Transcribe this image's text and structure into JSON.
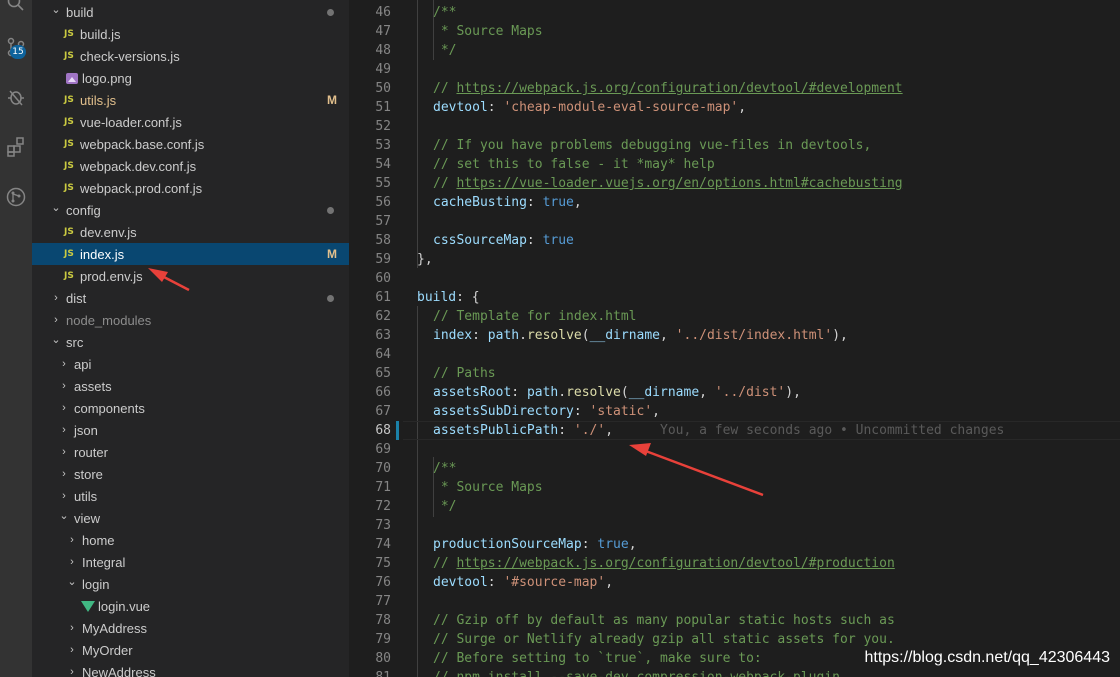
{
  "activity_bar": {
    "icons": [
      "search-icon",
      "source-control-icon",
      "debug-icon",
      "extensions-icon",
      "git-graph-icon"
    ],
    "scm_badge": "15"
  },
  "explorer": {
    "rows": [
      {
        "label": "build",
        "kind": "folder-open",
        "indent": 0,
        "marker": "dot"
      },
      {
        "label": "build.js",
        "kind": "js",
        "indent": 1
      },
      {
        "label": "check-versions.js",
        "kind": "js",
        "indent": 1
      },
      {
        "label": "logo.png",
        "kind": "img",
        "indent": 1
      },
      {
        "label": "utils.js",
        "kind": "js",
        "indent": 1,
        "status": "M"
      },
      {
        "label": "vue-loader.conf.js",
        "kind": "js",
        "indent": 1
      },
      {
        "label": "webpack.base.conf.js",
        "kind": "js",
        "indent": 1
      },
      {
        "label": "webpack.dev.conf.js",
        "kind": "js",
        "indent": 1
      },
      {
        "label": "webpack.prod.conf.js",
        "kind": "js",
        "indent": 1
      },
      {
        "label": "config",
        "kind": "folder-open",
        "indent": 0,
        "marker": "dot"
      },
      {
        "label": "dev.env.js",
        "kind": "js",
        "indent": 1
      },
      {
        "label": "index.js",
        "kind": "js",
        "indent": 1,
        "status": "M",
        "selected": true
      },
      {
        "label": "prod.env.js",
        "kind": "js",
        "indent": 1
      },
      {
        "label": "dist",
        "kind": "folder-closed",
        "indent": 0,
        "marker": "dot"
      },
      {
        "label": "node_modules",
        "kind": "folder-closed",
        "indent": 0,
        "dim": true
      },
      {
        "label": "src",
        "kind": "folder-open",
        "indent": 0
      },
      {
        "label": "api",
        "kind": "folder-closed",
        "indent": 1
      },
      {
        "label": "assets",
        "kind": "folder-closed",
        "indent": 1
      },
      {
        "label": "components",
        "kind": "folder-closed",
        "indent": 1
      },
      {
        "label": "json",
        "kind": "folder-closed",
        "indent": 1
      },
      {
        "label": "router",
        "kind": "folder-closed",
        "indent": 1
      },
      {
        "label": "store",
        "kind": "folder-closed",
        "indent": 1
      },
      {
        "label": "utils",
        "kind": "folder-closed",
        "indent": 1
      },
      {
        "label": "view",
        "kind": "folder-open",
        "indent": 1
      },
      {
        "label": "home",
        "kind": "folder-closed",
        "indent": 2
      },
      {
        "label": "Integral",
        "kind": "folder-closed",
        "indent": 2
      },
      {
        "label": "login",
        "kind": "folder-open",
        "indent": 2
      },
      {
        "label": "login.vue",
        "kind": "vue",
        "indent": 3
      },
      {
        "label": "MyAddress",
        "kind": "folder-closed",
        "indent": 2
      },
      {
        "label": "MyOrder",
        "kind": "folder-closed",
        "indent": 2
      },
      {
        "label": "NewAddress",
        "kind": "folder-closed",
        "indent": 2
      }
    ]
  },
  "editor": {
    "active_line": 68,
    "lines": [
      {
        "n": 46,
        "indent": 2,
        "tokens": [
          [
            "c",
            "/**"
          ]
        ]
      },
      {
        "n": 47,
        "indent": 2,
        "tokens": [
          [
            "c",
            " * Source Maps"
          ]
        ]
      },
      {
        "n": 48,
        "indent": 2,
        "tokens": [
          [
            "c",
            " */"
          ]
        ]
      },
      {
        "n": 49,
        "indent": 0,
        "tokens": []
      },
      {
        "n": 50,
        "indent": 2,
        "tokens": [
          [
            "c",
            "// "
          ],
          [
            "u",
            "https://webpack.js.org/configuration/devtool/#development"
          ]
        ]
      },
      {
        "n": 51,
        "indent": 2,
        "tokens": [
          [
            "k",
            "devtool"
          ],
          [
            "p",
            ": "
          ],
          [
            "s",
            "'cheap-module-eval-source-map'"
          ],
          [
            "p",
            ","
          ]
        ]
      },
      {
        "n": 52,
        "indent": 0,
        "tokens": []
      },
      {
        "n": 53,
        "indent": 2,
        "tokens": [
          [
            "c",
            "// If you have problems debugging vue-files in devtools,"
          ]
        ]
      },
      {
        "n": 54,
        "indent": 2,
        "tokens": [
          [
            "c",
            "// set this to false - it *may* help"
          ]
        ]
      },
      {
        "n": 55,
        "indent": 2,
        "tokens": [
          [
            "c",
            "// "
          ],
          [
            "u",
            "https://vue-loader.vuejs.org/en/options.html#cachebusting"
          ]
        ]
      },
      {
        "n": 56,
        "indent": 2,
        "tokens": [
          [
            "k",
            "cacheBusting"
          ],
          [
            "p",
            ": "
          ],
          [
            "b",
            "true"
          ],
          [
            "p",
            ","
          ]
        ]
      },
      {
        "n": 57,
        "indent": 0,
        "tokens": []
      },
      {
        "n": 58,
        "indent": 2,
        "tokens": [
          [
            "k",
            "cssSourceMap"
          ],
          [
            "p",
            ": "
          ],
          [
            "b",
            "true"
          ]
        ]
      },
      {
        "n": 59,
        "indent": 1,
        "tokens": [
          [
            "p",
            "},"
          ]
        ]
      },
      {
        "n": 60,
        "indent": 0,
        "tokens": []
      },
      {
        "n": 61,
        "indent": 1,
        "tokens": [
          [
            "k",
            "build"
          ],
          [
            "p",
            ": {"
          ]
        ]
      },
      {
        "n": 62,
        "indent": 2,
        "tokens": [
          [
            "c",
            "// Template for index.html"
          ]
        ]
      },
      {
        "n": 63,
        "indent": 2,
        "tokens": [
          [
            "k",
            "index"
          ],
          [
            "p",
            ": "
          ],
          [
            "k",
            "path"
          ],
          [
            "p",
            "."
          ],
          [
            "f",
            "resolve"
          ],
          [
            "p",
            "("
          ],
          [
            "k",
            "__dirname"
          ],
          [
            "p",
            ", "
          ],
          [
            "s",
            "'../dist/index.html'"
          ],
          [
            "p",
            "),"
          ]
        ]
      },
      {
        "n": 64,
        "indent": 0,
        "tokens": []
      },
      {
        "n": 65,
        "indent": 2,
        "tokens": [
          [
            "c",
            "// Paths"
          ]
        ]
      },
      {
        "n": 66,
        "indent": 2,
        "tokens": [
          [
            "k",
            "assetsRoot"
          ],
          [
            "p",
            ": "
          ],
          [
            "k",
            "path"
          ],
          [
            "p",
            "."
          ],
          [
            "f",
            "resolve"
          ],
          [
            "p",
            "("
          ],
          [
            "k",
            "__dirname"
          ],
          [
            "p",
            ", "
          ],
          [
            "s",
            "'../dist'"
          ],
          [
            "p",
            "),"
          ]
        ]
      },
      {
        "n": 67,
        "indent": 2,
        "tokens": [
          [
            "k",
            "assetsSubDirectory"
          ],
          [
            "p",
            ": "
          ],
          [
            "s",
            "'static'"
          ],
          [
            "p",
            ","
          ]
        ]
      },
      {
        "n": 68,
        "indent": 2,
        "tokens": [
          [
            "k",
            "assetsPublicPath"
          ],
          [
            "p",
            ": "
          ],
          [
            "s",
            "'./'"
          ],
          [
            "p",
            ","
          ],
          [
            "blame",
            "      You, a few seconds ago • Uncommitted changes"
          ]
        ]
      },
      {
        "n": 69,
        "indent": 0,
        "tokens": []
      },
      {
        "n": 70,
        "indent": 2,
        "tokens": [
          [
            "c",
            "/**"
          ]
        ]
      },
      {
        "n": 71,
        "indent": 2,
        "tokens": [
          [
            "c",
            " * Source Maps"
          ]
        ]
      },
      {
        "n": 72,
        "indent": 2,
        "tokens": [
          [
            "c",
            " */"
          ]
        ]
      },
      {
        "n": 73,
        "indent": 0,
        "tokens": []
      },
      {
        "n": 74,
        "indent": 2,
        "tokens": [
          [
            "k",
            "productionSourceMap"
          ],
          [
            "p",
            ": "
          ],
          [
            "b",
            "true"
          ],
          [
            "p",
            ","
          ]
        ]
      },
      {
        "n": 75,
        "indent": 2,
        "tokens": [
          [
            "c",
            "// "
          ],
          [
            "u",
            "https://webpack.js.org/configuration/devtool/#production"
          ]
        ]
      },
      {
        "n": 76,
        "indent": 2,
        "tokens": [
          [
            "k",
            "devtool"
          ],
          [
            "p",
            ": "
          ],
          [
            "s",
            "'#source-map'"
          ],
          [
            "p",
            ","
          ]
        ]
      },
      {
        "n": 77,
        "indent": 0,
        "tokens": []
      },
      {
        "n": 78,
        "indent": 2,
        "tokens": [
          [
            "c",
            "// Gzip off by default as many popular static hosts such as"
          ]
        ]
      },
      {
        "n": 79,
        "indent": 2,
        "tokens": [
          [
            "c",
            "// Surge or Netlify already gzip all static assets for you."
          ]
        ]
      },
      {
        "n": 80,
        "indent": 2,
        "tokens": [
          [
            "c",
            "// Before setting to `true`, make sure to:"
          ]
        ]
      },
      {
        "n": 81,
        "indent": 2,
        "tokens": [
          [
            "c",
            "// npm install --save-dev compression-webpack-plugin"
          ]
        ]
      }
    ]
  },
  "watermark": "https://blog.csdn.net/qq_42306443",
  "colors": {
    "selection": "#094771",
    "modified": "#e2c08d",
    "arrow": "#e8413a",
    "js_icon": "#cbcb41"
  }
}
